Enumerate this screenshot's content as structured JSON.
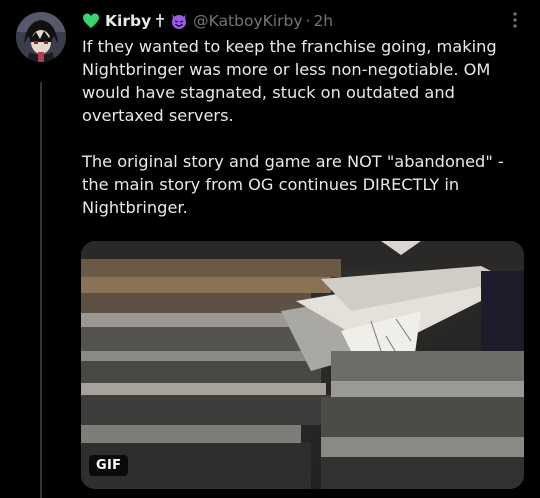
{
  "tweet": {
    "display_name": "Kirby",
    "handle": "@KatboyKirby",
    "separator": "·",
    "time": "2h",
    "paragraphs": [
      "If they wanted to keep the franchise going, making Nightbringer was more or less non-negotiable. OM would have stagnated, stuck on outdated and overtaxed servers.",
      "The original story and game are NOT \"abandoned\" - the main story from OG continues DIRECTLY in Nightbringer."
    ],
    "media_badge": "GIF"
  },
  "icons": {
    "name_prefix": "green-heart-icon",
    "name_suffix_1": "dagger-icon",
    "name_suffix_2": "smiling-devil-icon",
    "more": "more-options-icon"
  },
  "colors": {
    "background": "#000000",
    "text": "#e7e9ea",
    "muted": "#71767b",
    "heart": "#3ad46f",
    "devil": "#9b5de5"
  }
}
